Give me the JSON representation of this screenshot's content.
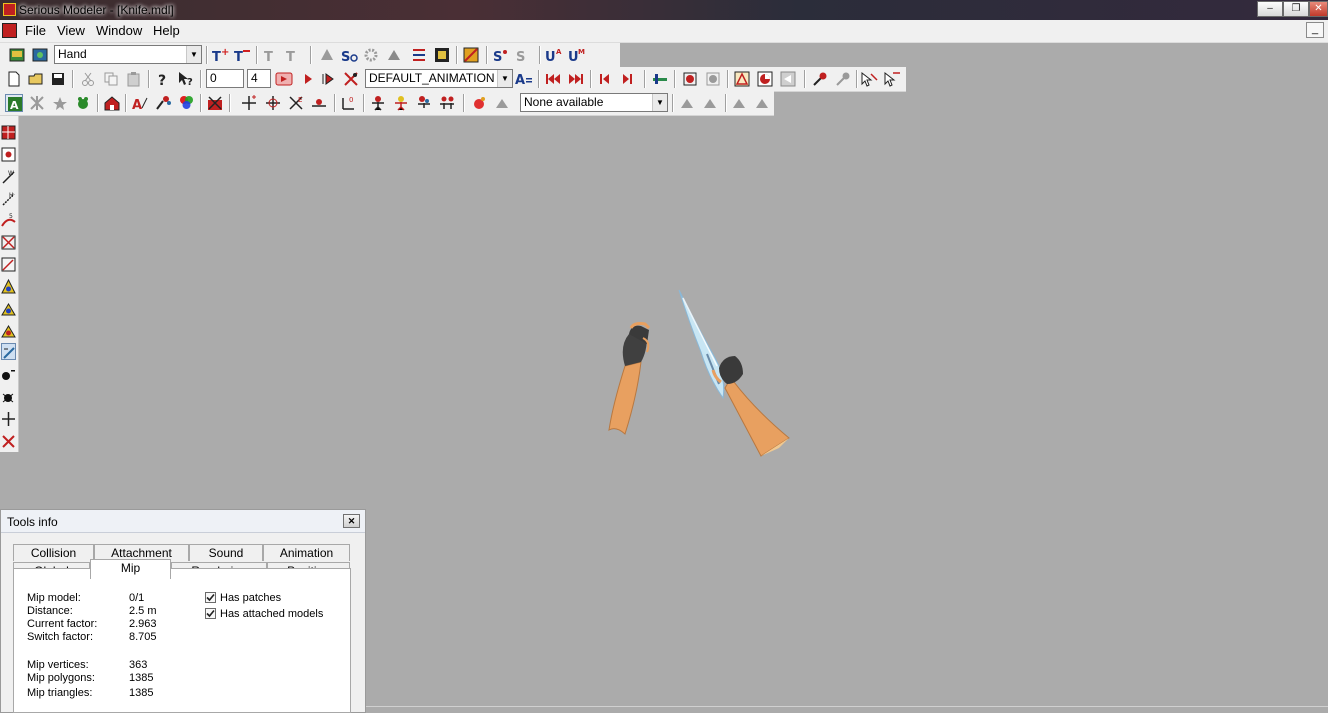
{
  "window": {
    "title": "Serious Modeler - [Knife.mdl]"
  },
  "menubar": {
    "items": [
      "File",
      "View",
      "Window",
      "Help"
    ]
  },
  "toolbar1": {
    "mode_combo": "Hand"
  },
  "toolbar2": {
    "frame_value": "0",
    "frame_count": "4",
    "animation_combo": "DEFAULT_ANIMATION"
  },
  "toolbar3": {
    "attachment_combo": "None available"
  },
  "tools_info": {
    "title": "Tools info",
    "tabs_row1": [
      "Collision",
      "Attachment",
      "Sound",
      "Animation"
    ],
    "tabs_row2": [
      "Global",
      "Mip",
      "Rendering",
      "Position"
    ],
    "active_tab": "Mip",
    "fields": [
      {
        "label": "Mip model:",
        "value": "0/1"
      },
      {
        "label": "Distance:",
        "value": "2.5 m"
      },
      {
        "label": "Current factor:",
        "value": "2.963"
      },
      {
        "label": "Switch factor:",
        "value": "8.705"
      },
      {
        "label": "Mip vertices:",
        "value": "363"
      },
      {
        "label": "Mip polygons:",
        "value": "1385"
      },
      {
        "label": "Mip triangles:",
        "value": "1385"
      }
    ],
    "checkboxes": [
      {
        "label": "Has patches",
        "checked": true
      },
      {
        "label": "Has attached models",
        "checked": true
      }
    ]
  },
  "colors": {
    "viewport_bg": "#ababab",
    "skin": "#e8a060",
    "glove": "#3a3a3a",
    "blade": "#c8e6f4"
  }
}
